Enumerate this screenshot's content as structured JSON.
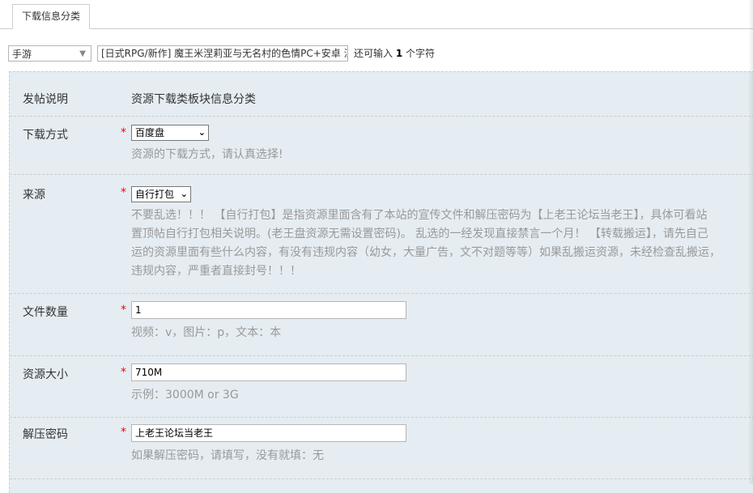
{
  "tabs": {
    "active": "下载信息分类"
  },
  "topbar": {
    "category_value": "手游",
    "title_value": "[日式RPG/新作] 魔王米涅莉亚与无名村的色情PC+安卓 汉",
    "counter_prefix": "还可输入",
    "counter_num": "1",
    "counter_suffix": "个字符"
  },
  "form": {
    "desc": {
      "label": "发帖说明",
      "value": "资源下载类板块信息分类"
    },
    "download": {
      "label": "下载方式",
      "required": "*",
      "selected": "百度盘",
      "hint": "资源的下载方式，请认真选择!"
    },
    "source": {
      "label": "来源",
      "required": "*",
      "selected": "自行打包",
      "hint_lines": [
        "不要乱选！！！ 【自行打包】是指资源里面含有了本站的宣传文件和解压密码为【上老王论坛当老王】，具体可看站",
        "置顶帖自行打包相关说明。(老王盘资源无需设置密码)。 乱选的一经发现直接禁言一个月！ 【转载搬运】，请先自己",
        "运的资源里面有些什么内容，有没有违规内容（幼女，大量广告，文不对题等等）如果乱搬运资源，未经检查乱搬运，",
        "违规内容，严重者直接封号！！！"
      ]
    },
    "files": {
      "label": "文件数量",
      "required": "*",
      "value": "1",
      "hint": "视频：v，图片：p，文本：本"
    },
    "size": {
      "label": "资源大小",
      "required": "*",
      "value": "710M",
      "hint": "示例：3000M or 3G"
    },
    "password": {
      "label": "解压密码",
      "required": "*",
      "value": "上老王论坛当老王",
      "hint": "如果解压密码，请填写，没有就填：无"
    }
  }
}
